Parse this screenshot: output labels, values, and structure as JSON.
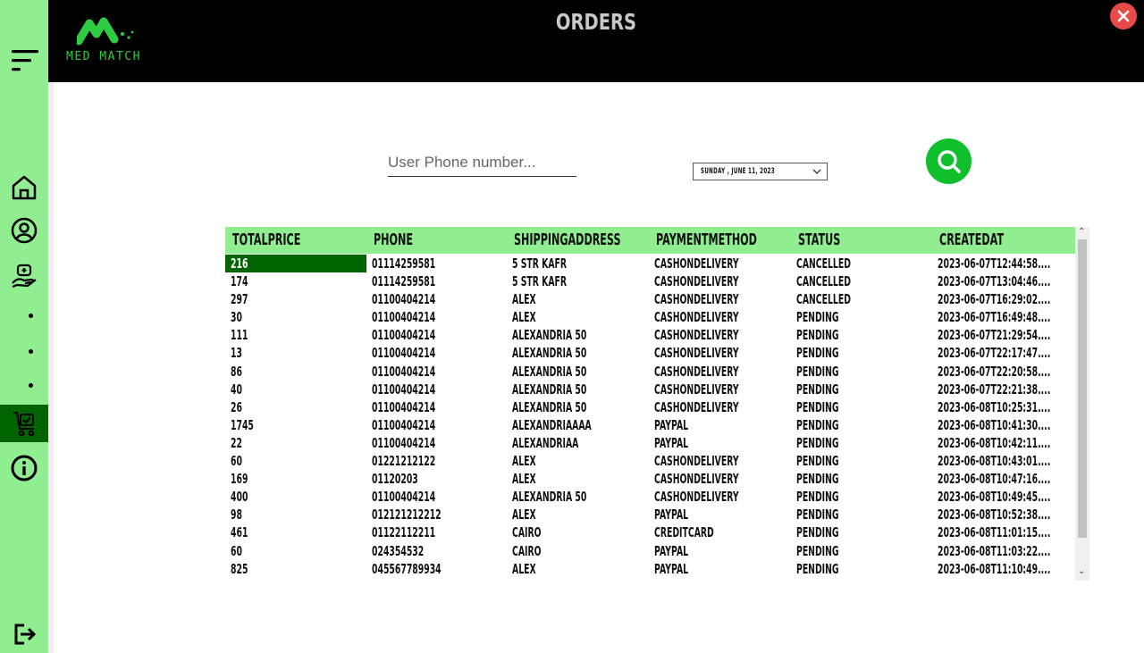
{
  "app": {
    "brand": "MED MATCH",
    "page_title": "ORDERS"
  },
  "sidebar": {
    "items": [
      {
        "name": "menu-icon"
      },
      {
        "name": "home-icon"
      },
      {
        "name": "user-circle-icon"
      },
      {
        "name": "pharmacy-icon"
      },
      {
        "name": "orders-cart-icon",
        "active": true
      },
      {
        "name": "info-icon"
      },
      {
        "name": "logout-icon"
      }
    ]
  },
  "search": {
    "phone_placeholder": "User Phone number...",
    "date_value": "SUNDAY  ,   JUNE    11, 2023"
  },
  "colors": {
    "accent": "#90ee90",
    "selected": "#006400",
    "search_button": "#0fbf2c",
    "close": "#e84a4a"
  },
  "table": {
    "columns": [
      "TOTALPRICE",
      "PHONE",
      "SHIPPINGADDRESS",
      "PAYMENTMETHOD",
      "STATUS",
      "CREATEDAT"
    ],
    "rows": [
      [
        "216",
        "01114259581",
        "5 STR KAFR",
        "CASHONDELIVERY",
        "CANCELLED",
        "2023-06-07T12:44:58...."
      ],
      [
        "174",
        "01114259581",
        "5 STR KAFR",
        "CASHONDELIVERY",
        "CANCELLED",
        "2023-06-07T13:04:46...."
      ],
      [
        "297",
        "01100404214",
        "ALEX",
        "CASHONDELIVERY",
        "CANCELLED",
        "2023-06-07T16:29:02...."
      ],
      [
        "30",
        "01100404214",
        "ALEX",
        "CASHONDELIVERY",
        "PENDING",
        "2023-06-07T16:49:48...."
      ],
      [
        "111",
        "01100404214",
        "ALEXANDRIA 50",
        "CASHONDELIVERY",
        "PENDING",
        "2023-06-07T21:29:54...."
      ],
      [
        "13",
        "01100404214",
        "ALEXANDRIA 50",
        "CASHONDELIVERY",
        "PENDING",
        "2023-06-07T22:17:47...."
      ],
      [
        "86",
        "01100404214",
        "ALEXANDRIA 50",
        "CASHONDELIVERY",
        "PENDING",
        "2023-06-07T22:20:58...."
      ],
      [
        "40",
        "01100404214",
        "ALEXANDRIA 50",
        "CASHONDELIVERY",
        "PENDING",
        "2023-06-07T22:21:38...."
      ],
      [
        "26",
        "01100404214",
        "ALEXANDRIA 50",
        "CASHONDELIVERY",
        "PENDING",
        "2023-06-08T10:25:31...."
      ],
      [
        "1745",
        "01100404214",
        "ALEXANDRIAAAA",
        "PAYPAL",
        "PENDING",
        "2023-06-08T10:41:30...."
      ],
      [
        "22",
        "01100404214",
        "ALEXANDRIAA",
        "PAYPAL",
        "PENDING",
        "2023-06-08T10:42:11...."
      ],
      [
        "60",
        "01221212122",
        "ALEX",
        "CASHONDELIVERY",
        "PENDING",
        "2023-06-08T10:43:01...."
      ],
      [
        "169",
        "01120203",
        "ALEX",
        "CASHONDELIVERY",
        "PENDING",
        "2023-06-08T10:47:16...."
      ],
      [
        "400",
        "01100404214",
        "ALEXANDRIA 50",
        "CASHONDELIVERY",
        "PENDING",
        "2023-06-08T10:49:45...."
      ],
      [
        "98",
        "012121212212",
        "ALEX",
        "PAYPAL",
        "PENDING",
        "2023-06-08T10:52:38...."
      ],
      [
        "461",
        "01122112211",
        "CAIRO",
        "CREDITCARD",
        "PENDING",
        "2023-06-08T11:01:15...."
      ],
      [
        "60",
        "024354532",
        "CAIRO",
        "PAYPAL",
        "PENDING",
        "2023-06-08T11:03:22...."
      ],
      [
        "825",
        "045567789934",
        "ALEX",
        "PAYPAL",
        "PENDING",
        "2023-06-08T11:10:49...."
      ]
    ]
  }
}
